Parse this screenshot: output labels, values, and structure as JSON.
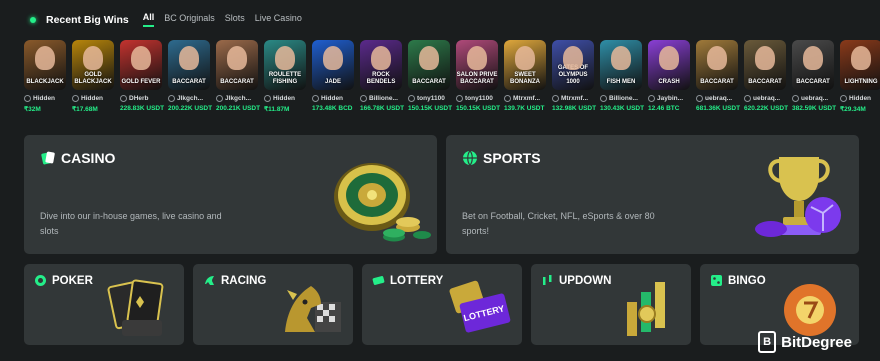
{
  "header": {
    "title": "Recent Big Wins",
    "tabs": [
      "All",
      "BC Originals",
      "Slots",
      "Live Casino"
    ]
  },
  "wins": [
    {
      "game": "BLACKJACK",
      "user": "Hidden",
      "amount": "₹32M",
      "color": "#8a5a2b"
    },
    {
      "game": "GOLD BLACKJACK",
      "user": "Hidden",
      "amount": "₹17.68M",
      "color": "#b8860b"
    },
    {
      "game": "GOLD FEVER",
      "user": "DHerb",
      "amount": "228.83K USDT",
      "color": "#c4332f"
    },
    {
      "game": "BACCARAT",
      "user": "Jlkgch...",
      "amount": "200.22K USDT",
      "color": "#2e6b8f"
    },
    {
      "game": "BACCARAT",
      "user": "Jlkgch...",
      "amount": "200.21K USDT",
      "color": "#9b6a4a"
    },
    {
      "game": "ROULETTE FISHING",
      "user": "Hidden",
      "amount": "₹11.87M",
      "color": "#2b8a86"
    },
    {
      "game": "JADE",
      "user": "Hidden",
      "amount": "173.48K BCD",
      "color": "#1f5fd1"
    },
    {
      "game": "ROCK BENDELS",
      "user": "Billione...",
      "amount": "166.78K USDT",
      "color": "#5b2a8c"
    },
    {
      "game": "BACCARAT",
      "user": "tony1100",
      "amount": "150.15K USDT",
      "color": "#2d7a4a"
    },
    {
      "game": "SALON PRIVE BACCARAT",
      "user": "tony1100",
      "amount": "150.15K USDT",
      "color": "#b04a7a"
    },
    {
      "game": "SWEET BONANZA",
      "user": "Mtrxmf...",
      "amount": "139.7K USDT",
      "color": "#e0a83c"
    },
    {
      "game": "GATES OF OLYMPUS 1000",
      "user": "Mtrxmf...",
      "amount": "132.98K USDT",
      "color": "#3f4fa8"
    },
    {
      "game": "FISH MEN",
      "user": "Billione...",
      "amount": "130.43K USDT",
      "color": "#2f8fa8"
    },
    {
      "game": "CRASH",
      "user": "Jaybin...",
      "amount": "12.46 BTC",
      "color": "#8a3fd6"
    },
    {
      "game": "BACCARAT",
      "user": "uebraq...",
      "amount": "681.36K USDT",
      "color": "#a07a3a"
    },
    {
      "game": "BACCARAT",
      "user": "uebraq...",
      "amount": "620.22K USDT",
      "color": "#6a5a3a"
    },
    {
      "game": "BACCARAT",
      "user": "uebraq...",
      "amount": "382.59K USDT",
      "color": "#4a4a4a"
    },
    {
      "game": "LIGHTNING",
      "user": "Hidden",
      "amount": "₹29.34M",
      "color": "#8a3a1a"
    }
  ],
  "casino": {
    "title": "CASINO",
    "desc": "Dive into our in-house games, live casino and slots"
  },
  "sports": {
    "title": "SPORTS",
    "desc": "Bet on Football, Cricket, NFL, eSports & over 80 sports!"
  },
  "categories": [
    {
      "title": "POKER",
      "icon": "poker-icon"
    },
    {
      "title": "RACING",
      "icon": "racing-icon"
    },
    {
      "title": "LOTTERY",
      "icon": "lottery-icon"
    },
    {
      "title": "UPDOWN",
      "icon": "updown-icon"
    },
    {
      "title": "BINGO",
      "icon": "bingo-icon"
    }
  ],
  "lottery_ticket": "LOTTERY",
  "watermark": "BitDegree",
  "colors": {
    "accent": "#24ee89",
    "card": "#323738",
    "background": "#1a1d1e"
  }
}
